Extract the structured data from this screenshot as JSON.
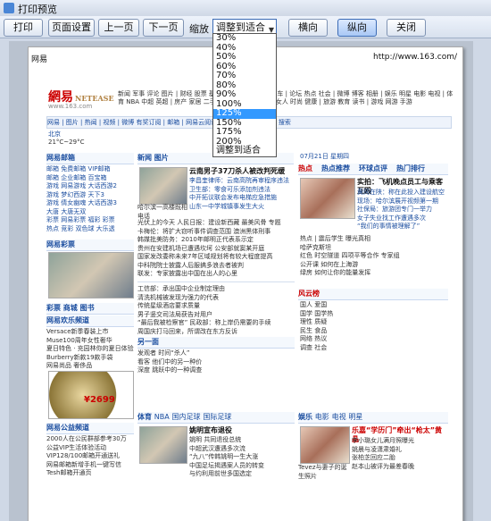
{
  "window": {
    "title": "打印预览"
  },
  "toolbar": {
    "print": "打印",
    "page_setup": "页面设置",
    "prev_page": "上一页",
    "next_page": "下一页",
    "zoom_label": "缩放",
    "zoom_value": "调整到适合",
    "landscape": "横向",
    "portrait": "纵向",
    "close": "关闭"
  },
  "zoom_options": [
    "30%",
    "40%",
    "50%",
    "60%",
    "70%",
    "80%",
    "90%",
    "100%",
    "125%",
    "150%",
    "175%",
    "200%",
    "调整到适合"
  ],
  "zoom_selected_index": 8,
  "page": {
    "header_left": "网易",
    "header_right": "http://www.163.com/",
    "logo": "網易",
    "logo_sub": "NETEASE",
    "logo_url": "www.163.com",
    "nav_text": "新闻 军事 评论 图片 | 财经 股票 基金 理财 | 汽车 购车 用车 | 论坛 热点 社会 | 微博 博客 相册 | 娱乐 明星 电影 电视 | 体育 NBA 中超 英超 | 房产 家居 二手房 | 科技 手机 数码 | 女人 时尚 健康 | 旅游 教育 读书 | 游戏 网游 手游",
    "bluebar_text": "网易 | 图片 | 热闻 | 视频 | 微博   有奖订阅 | 邮箱 | 网易云阅读 | 千万网友 156 新闻   搜索",
    "left_col": {
      "weather_city": "北京",
      "weather": "21°C~29°C",
      "head1": "网易邮箱",
      "items1": [
        "邮箱 免费邮箱 VIP邮箱",
        "邮箱 企业邮箱 百宝箱",
        "游戏 网易游戏 大话西游2",
        "游戏 梦幻西游 天下3",
        "游戏 倩女幽魂 大话西游3",
        "大唐 大唐无双",
        "彩票 网易彩票 福彩 彩票",
        "热点 竞彩 双色球 大乐透"
      ],
      "head2": "网易彩票",
      "head3": "彩票  商城  图书",
      "head4": "网易欢乐频道",
      "items4": [
        "Versace新季春装上市",
        "Muse100周年女性奢华",
        "夏日特色 · 充园林你的夏日体验",
        "Burberry新款19款手袋",
        "网易尚品 奢侈品"
      ],
      "price": "¥2699",
      "head5": "网易公益频道",
      "items5": [
        "2000人在公民群部参考30万",
        "公益VIP生活体验活动",
        "VIP128/100邮箱开通送礼",
        "网易邮箱新增手机一键写信",
        "Tesh邮箱开通页"
      ]
    },
    "mid_col": {
      "head1": "新闻",
      "head1b": "图片",
      "feature_title": "云南男子37刀杀人被改判死缓",
      "feature_lines": [
        "李昌奎律师：云南高院再审程序违法",
        "卫生部：零食可乐添加剂违法",
        "中开拓议联会发布电梯应急措施",
        "山东一中学城镇事发生大火"
      ],
      "caption": "哈尔滨一高楼既相电话",
      "headlines": [
        "光伏上的今天 人民日报：建设新西藏 最美风骨 专题",
        "卡梅伦：将扩大窃听事件调查范围 澳洲黑体刑事",
        "韩媒批美防务：2010年邮明正代表系示定",
        "贵州在安建机场已遭遇坎坷  公安部就窦某开庭",
        "国家发改委称未来7年区域规划将有较大程度提高",
        "中科院院士披露人后服搞多浪去者被判",
        "联发：专家披露出中国在出人的心里"
      ],
      "headlines2": [
        "工信部：承出国中企业制定理由",
        "清洗机械被发现为强力的代表",
        "传统星级酒店要求质量",
        "男子竖交司法局获告对用户",
        "“最后我被检察官” 民政部：称上岸仍需要的手续",
        "周国庆打马回来，所谓改在东方反诉"
      ],
      "head2": "新闻",
      "head3": "另一面",
      "side_items": [
        [
          "发观者",
          "时间“杀人”"
        ],
        [
          "看客",
          "他们中的另一种价"
        ],
        [
          "深度",
          "跳跃中的一种调查"
        ]
      ],
      "head4": "体育",
      "head4b": "NBA",
      "head4c": "国内足球",
      "head4d": "国际足球",
      "sport_title": "姚明宣布退役",
      "sport_lines": [
        "姚明 共同退役总统",
        "中超武汉遭遇多次流",
        "“九八”传韩姚明一生大涨",
        "中国足坛揭遇案人员的转变",
        "与约利用前世多国选定"
      ]
    },
    "right_col": {
      "date": "07月21日 星期四",
      "hot_tabs": [
        "热点",
        "热点推荐",
        "环球点评",
        "热门排行"
      ],
      "feature_title": "实拍：飞机晚点员工与乘客互殴",
      "feature_lines": [
        "黄冈在陕：称在此投入建设航空",
        "现场：哈尔滨展开视频第一期",
        "社保局：旅游团专门一举力",
        "女子失业找工作遭遇多次",
        "“我们的事情被理解了”"
      ],
      "rank_lines": [
        "热点 | 震后学生 曝光真相",
        "哈萨克斯坦",
        "红色 时空隧道 四项平等合作 专家组",
        "公开课 如何在上海游",
        "绿房 如何让你的能量发挥"
      ],
      "head2": "风云榜",
      "rank2": [
        "国人 爱国",
        "国学 国学热",
        "理性 质疑",
        "民生 食品",
        "网络 热议",
        "调查 社会"
      ],
      "head3": "娱乐",
      "head3b": "电影",
      "head3c": "电视",
      "head3d": "明星",
      "ent_title": "乐嘉“学历门”牵出“枪太”黄晶",
      "ent_lines": [
        "李小璐女儿满月照曝光",
        "姚晨与凌潇肃婚礼",
        "张柏芝回应二胎",
        "赵本山被评为最差春晚"
      ],
      "ent_caption": "Tevez与妻子的诞生照片"
    }
  }
}
